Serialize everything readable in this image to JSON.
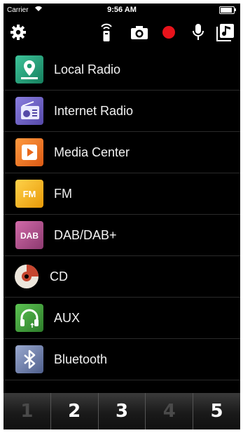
{
  "status_bar": {
    "carrier": "Carrier",
    "time": "9:56 AM",
    "battery_level": 1.0
  },
  "toolbar": {
    "icons": [
      "gear-icon",
      "remote-icon",
      "camera-icon",
      "record-icon",
      "microphone-icon",
      "music-note-icon"
    ],
    "record_color": "#e8131b"
  },
  "menu": {
    "items": [
      {
        "label": "Local Radio",
        "icon": "map-pin-icon",
        "color": "#2aa27e"
      },
      {
        "label": "Internet Radio",
        "icon": "radio-icon",
        "color": "#7467c4"
      },
      {
        "label": "Media Center",
        "icon": "play-icon",
        "color": "#f07a28"
      },
      {
        "label": "FM",
        "icon": "fm-icon",
        "color": "#f2b31a"
      },
      {
        "label": "DAB/DAB+",
        "icon": "dab-icon",
        "color": "#b25691"
      },
      {
        "label": "CD",
        "icon": "disc-icon",
        "color": "#e8e2d8"
      },
      {
        "label": "AUX",
        "icon": "headphones-icon",
        "color": "#3fa03a"
      },
      {
        "label": "Bluetooth",
        "icon": "bluetooth-icon",
        "color": "#7d8fb9"
      }
    ]
  },
  "presets": [
    {
      "label": "1",
      "enabled": false
    },
    {
      "label": "2",
      "enabled": true
    },
    {
      "label": "3",
      "enabled": true
    },
    {
      "label": "4",
      "enabled": false
    },
    {
      "label": "5",
      "enabled": true
    }
  ]
}
